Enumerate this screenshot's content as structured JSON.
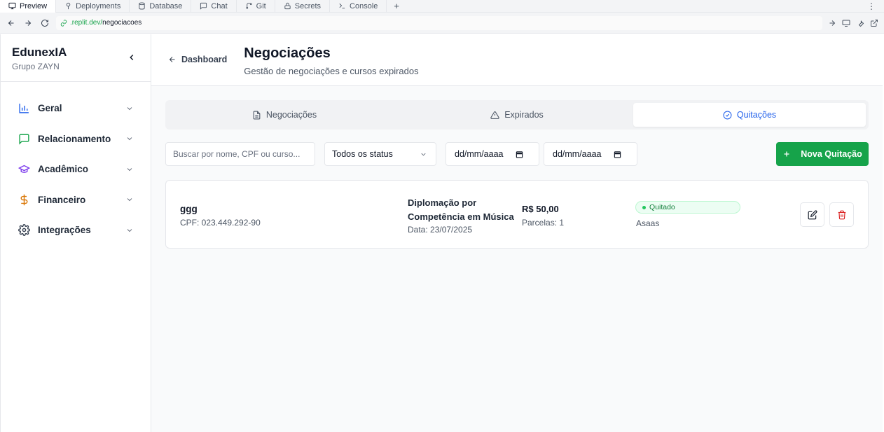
{
  "browser": {
    "tabs": [
      {
        "label": "Preview",
        "icon": "monitor-icon"
      },
      {
        "label": "Deployments",
        "icon": "tree-icon"
      },
      {
        "label": "Database",
        "icon": "database-icon"
      },
      {
        "label": "Chat",
        "icon": "chat-icon"
      },
      {
        "label": "Git",
        "icon": "git-icon"
      },
      {
        "label": "Secrets",
        "icon": "lock-icon"
      },
      {
        "label": "Console",
        "icon": "terminal-icon"
      }
    ],
    "url_domain": ".replit.dev/",
    "url_path": "negociacoes"
  },
  "sidebar": {
    "brand_title": "EdunexIA",
    "brand_subtitle": "Grupo ZAYN",
    "items": [
      {
        "label": "Geral",
        "icon": "bar-chart-icon",
        "color": "#2563eb"
      },
      {
        "label": "Relacionamento",
        "icon": "message-square-icon",
        "color": "#16a34a"
      },
      {
        "label": "Acadêmico",
        "icon": "graduation-cap-icon",
        "color": "#7c3aed"
      },
      {
        "label": "Financeiro",
        "icon": "dollar-icon",
        "color": "#d97706"
      },
      {
        "label": "Integrações",
        "icon": "gear-icon",
        "color": "#374151"
      }
    ]
  },
  "header": {
    "back_label": "Dashboard",
    "title": "Negociações",
    "subtitle": "Gestão de negociações e cursos expirados"
  },
  "tabs": [
    {
      "label": "Negociações",
      "icon": "file-text-icon"
    },
    {
      "label": "Expirados",
      "icon": "alert-triangle-icon"
    },
    {
      "label": "Quitações",
      "icon": "check-circle-icon"
    }
  ],
  "filters": {
    "search_placeholder": "Buscar por nome, CPF ou curso...",
    "status_value": "Todos os status",
    "date_from_placeholder": "dd/mm/aaaa",
    "date_to_placeholder": "dd/mm/aaaa",
    "new_button_label": "Nova Quitação"
  },
  "record": {
    "name": "ggg",
    "cpf": "CPF: 023.449.292-90",
    "course": "Diplomação por Competência em Música",
    "date": "Data: 23/07/2025",
    "amount": "R$ 50,00",
    "installments": "Parcelas: 1",
    "status": "Quitado",
    "payment_method": "Asaas"
  },
  "colors": {
    "accent_blue": "#2563eb",
    "primary_green": "#16a34a",
    "danger_red": "#dc2626"
  }
}
